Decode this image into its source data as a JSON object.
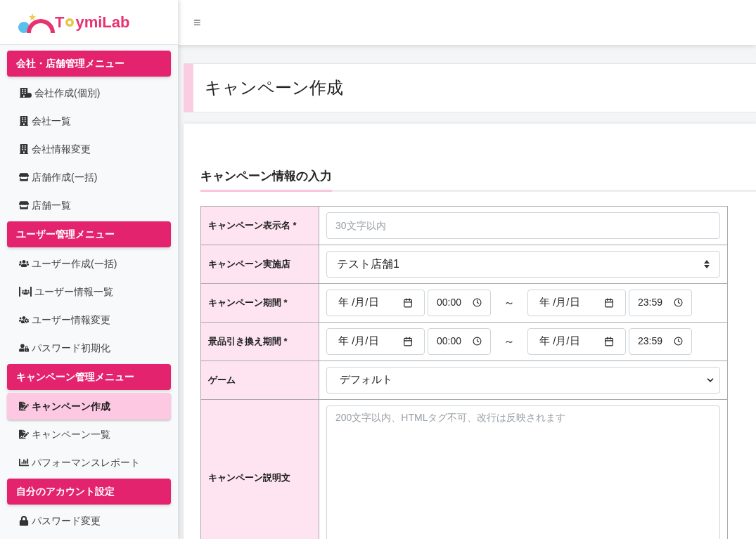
{
  "logo": {
    "text_start": "T",
    "text_end": "ymiLab"
  },
  "topbar": {
    "menu_glyph": "≡"
  },
  "sidebar": [
    {
      "header": "会社・店舗管理メニュー",
      "items": [
        {
          "label": "会社作成(個別)",
          "kind": "building-check",
          "selected": false
        },
        {
          "label": "会社一覧",
          "kind": "building",
          "selected": false
        },
        {
          "label": "会社情報変更",
          "kind": "building",
          "selected": false
        },
        {
          "label": "店舗作成(一括)",
          "kind": "store",
          "selected": false
        },
        {
          "label": "店舗一覧",
          "kind": "store",
          "selected": false
        }
      ]
    },
    {
      "header": "ユーザー管理メニュー",
      "items": [
        {
          "label": "ユーザー作成(一括)",
          "kind": "users",
          "selected": false
        },
        {
          "label": "ユーザー情報一覧",
          "kind": "users-frame",
          "selected": false
        },
        {
          "label": "ユーザー情報変更",
          "kind": "users-gear",
          "selected": false
        },
        {
          "label": "パスワード初期化",
          "kind": "user-lock",
          "selected": false
        }
      ]
    },
    {
      "header": "キャンペーン管理メニュー",
      "items": [
        {
          "label": "キャンペーン作成",
          "kind": "file-pen",
          "selected": true
        },
        {
          "label": "キャンペーン一覧",
          "kind": "file-pen",
          "selected": false
        },
        {
          "label": "パフォーマンスレポート",
          "kind": "chart",
          "selected": false
        }
      ]
    },
    {
      "header": "自分のアカウント設定",
      "items": [
        {
          "label": "パスワード変更",
          "kind": "lock",
          "selected": false
        }
      ]
    }
  ],
  "page_title": "キャンペーン作成",
  "section_title": "キャンペーン情報の入力",
  "form": [
    {
      "kind": "text",
      "label": "キャンペーン表示名 *",
      "placeholder": "30文字以内"
    },
    {
      "kind": "select",
      "label": "キャンペーン実施店",
      "value": "テスト店舗1"
    },
    {
      "kind": "period",
      "label": "キャンペーン期間 *",
      "start_date": "年 /月/日",
      "start_time": "00:00",
      "separator": "～",
      "end_date": "年 /月/日",
      "end_time": "23:59"
    },
    {
      "kind": "period",
      "label": "景品引き換え期間 *",
      "start_date": "年 /月/日",
      "start_time": "00:00",
      "separator": "～",
      "end_date": "年 /月/日",
      "end_time": "23:59"
    },
    {
      "kind": "dropdown",
      "label": "ゲーム",
      "value": "デフォルト"
    },
    {
      "kind": "textarea",
      "label": "キャンペーン説明文",
      "placeholder": "200文字以内、HTMLタグ不可、改行は反映されます"
    }
  ]
}
